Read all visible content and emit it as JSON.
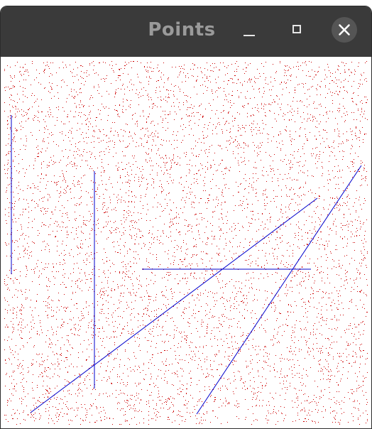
{
  "window": {
    "title": "Points",
    "controls": {
      "minimize_icon": "minimize-icon",
      "maximize_icon": "maximize-icon",
      "close_icon": "close-icon"
    }
  },
  "colors": {
    "titlebar": "#3a3a3a",
    "title_text": "#9a9a9a",
    "points": "#cc0000",
    "lines": "#0000cc",
    "close_button_bg": "#555555"
  },
  "canvas": {
    "point_color_name": "red",
    "line_color_name": "blue"
  }
}
